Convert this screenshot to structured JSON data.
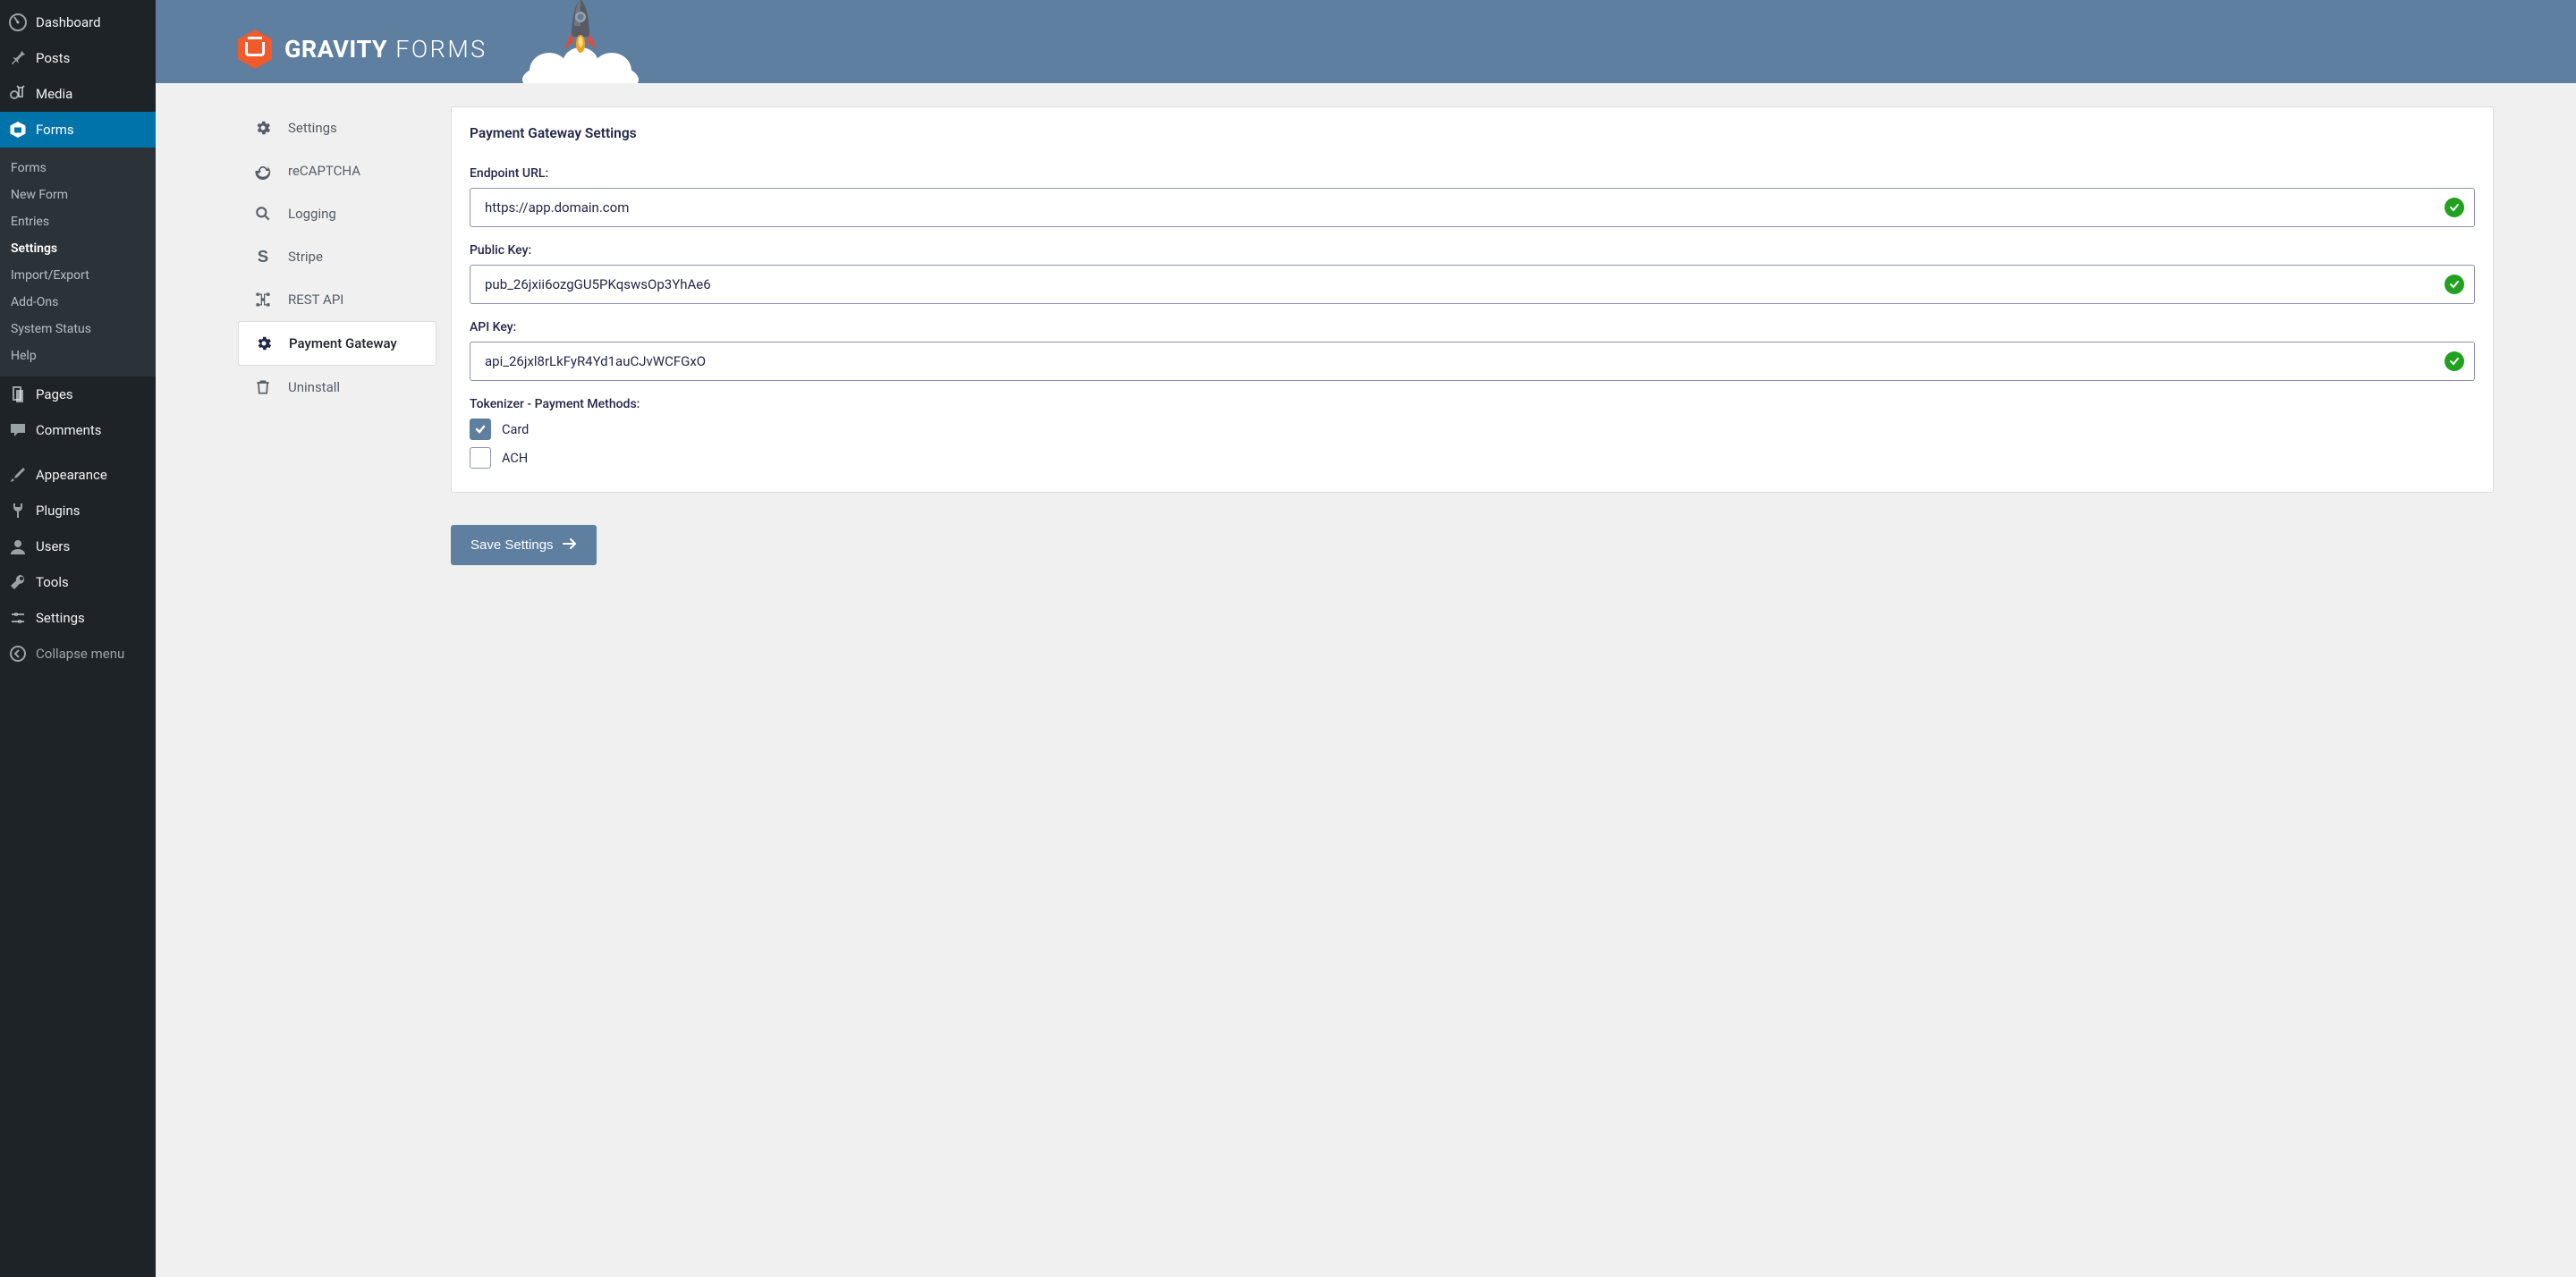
{
  "sidebar": {
    "top": [
      {
        "label": "Dashboard",
        "name": "dashboard"
      },
      {
        "label": "Posts",
        "name": "posts"
      },
      {
        "label": "Media",
        "name": "media"
      },
      {
        "label": "Forms",
        "name": "forms",
        "active": true
      }
    ],
    "sub": [
      {
        "label": "Forms",
        "name": "sub-forms"
      },
      {
        "label": "New Form",
        "name": "sub-new-form"
      },
      {
        "label": "Entries",
        "name": "sub-entries"
      },
      {
        "label": "Settings",
        "name": "sub-settings",
        "current": true
      },
      {
        "label": "Import/Export",
        "name": "sub-import-export"
      },
      {
        "label": "Add-Ons",
        "name": "sub-addons"
      },
      {
        "label": "System Status",
        "name": "sub-system-status"
      },
      {
        "label": "Help",
        "name": "sub-help"
      }
    ],
    "bottom": [
      {
        "label": "Pages",
        "name": "pages"
      },
      {
        "label": "Comments",
        "name": "comments"
      }
    ],
    "admin": [
      {
        "label": "Appearance",
        "name": "appearance"
      },
      {
        "label": "Plugins",
        "name": "plugins"
      },
      {
        "label": "Users",
        "name": "users"
      },
      {
        "label": "Tools",
        "name": "tools"
      },
      {
        "label": "Settings",
        "name": "settings-admin"
      }
    ],
    "collapse": "Collapse menu"
  },
  "banner": {
    "brand_bold": "GRAVITY",
    "brand_light": " FORMS"
  },
  "subnav": [
    {
      "label": "Settings",
      "name": "settings"
    },
    {
      "label": "reCAPTCHA",
      "name": "recaptcha"
    },
    {
      "label": "Logging",
      "name": "logging"
    },
    {
      "label": "Stripe",
      "name": "stripe"
    },
    {
      "label": "REST API",
      "name": "restapi"
    },
    {
      "label": "Payment Gateway",
      "name": "payment-gateway",
      "active": true
    },
    {
      "label": "Uninstall",
      "name": "uninstall"
    }
  ],
  "panel": {
    "title": "Payment Gateway Settings",
    "fields": {
      "endpoint": {
        "label": "Endpoint URL:",
        "value": "https://app.domain.com"
      },
      "public": {
        "label": "Public Key:",
        "value": "pub_26jxii6ozgGU5PKqswsOp3YhAe6"
      },
      "api": {
        "label": "API Key:",
        "value": "api_26jxl8rLkFyR4Yd1auCJvWCFGxO"
      },
      "tokenizer": {
        "label": "Tokenizer - Payment Methods:",
        "options": [
          {
            "label": "Card",
            "checked": true
          },
          {
            "label": "ACH",
            "checked": false
          }
        ]
      }
    },
    "save_label": "Save Settings"
  }
}
